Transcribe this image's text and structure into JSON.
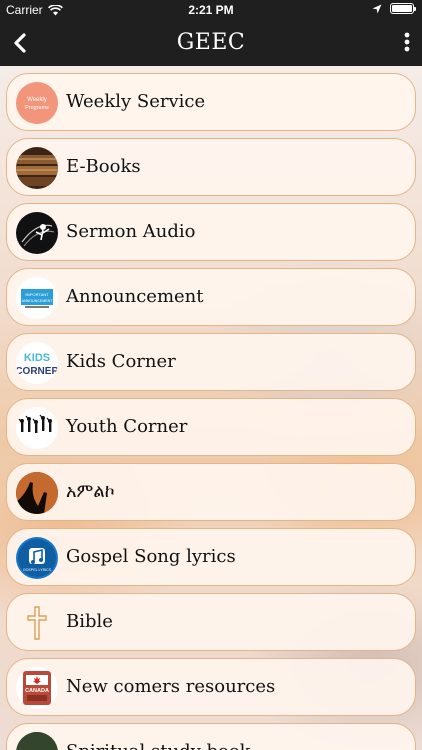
{
  "status_bar": {
    "carrier": "Carrier",
    "time": "2:21 PM"
  },
  "nav": {
    "title": "GEEC"
  },
  "menu": [
    {
      "label": "Weekly Service",
      "icon": "weekly-programs-icon",
      "icon_text_1": "Weekly",
      "icon_text_2": "Programs"
    },
    {
      "label": "E-Books",
      "icon": "books-icon"
    },
    {
      "label": "Sermon Audio",
      "icon": "sermon-audio-icon"
    },
    {
      "label": "Announcement",
      "icon": "announcement-icon",
      "icon_text_1": "IMPORTANT",
      "icon_text_2": "ANNOUNCEMENT"
    },
    {
      "label": "Kids Corner",
      "icon": "kids-corner-icon",
      "icon_text_1": "KIDS",
      "icon_text_2": "CORNER"
    },
    {
      "label": "Youth Corner",
      "icon": "youth-corner-icon"
    },
    {
      "label": "አምልኮ",
      "icon": "worship-icon"
    },
    {
      "label": "Gospel Song lyrics",
      "icon": "music-note-icon",
      "icon_text_1": "GOSPEL LYRICS"
    },
    {
      "label": "Bible",
      "icon": "cross-icon"
    },
    {
      "label": "New comers resources",
      "icon": "canada-icon",
      "icon_text_1": "CANADA"
    },
    {
      "label": "Spiritual study book",
      "icon": "study-book-icon"
    }
  ],
  "colors": {
    "bar": "#1f1f1f",
    "item_border": "#e3b489",
    "item_bg": "#fff5ee"
  }
}
